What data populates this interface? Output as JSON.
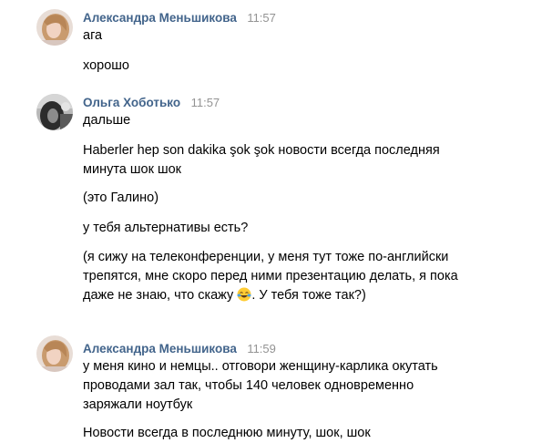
{
  "messages": [
    {
      "author": "Александра Меньшикова",
      "time": "11:57",
      "avatar_icon": "avatar-photo-woman-blonde",
      "lines": [
        "ага",
        "хорошо"
      ]
    },
    {
      "author": "Ольга Хоботько",
      "time": "11:57",
      "avatar_icon": "avatar-photo-woman-dark",
      "lines": [
        "дальше",
        "Haberler hep son dakika şok şok новости всегда последняя минута шок шок",
        "(это Галино)",
        "у тебя альтернативы есть?",
        "(я сижу на телеконференции, у меня тут тоже по-английски трепятся, мне скоро перед ними презентацию делать, я пока даже не знаю, что скажу ",
        ". У тебя тоже так?)"
      ],
      "emoji_icon": "tears-of-joy-emoji-icon"
    },
    {
      "author": "Александра Меньшикова",
      "time": "11:59",
      "avatar_icon": "avatar-photo-woman-blonde",
      "lines": [
        "у меня кино и немцы.. отговори женщину-карлика окутать проводами зал так, чтобы 140 человек одновременно заряжали ноутбук",
        "Новости всегда в последнюю минуту, шок, шок"
      ]
    }
  ],
  "colors": {
    "author_name": "#42648b",
    "time": "#939393",
    "text": "#000000",
    "background": "#ffffff"
  }
}
